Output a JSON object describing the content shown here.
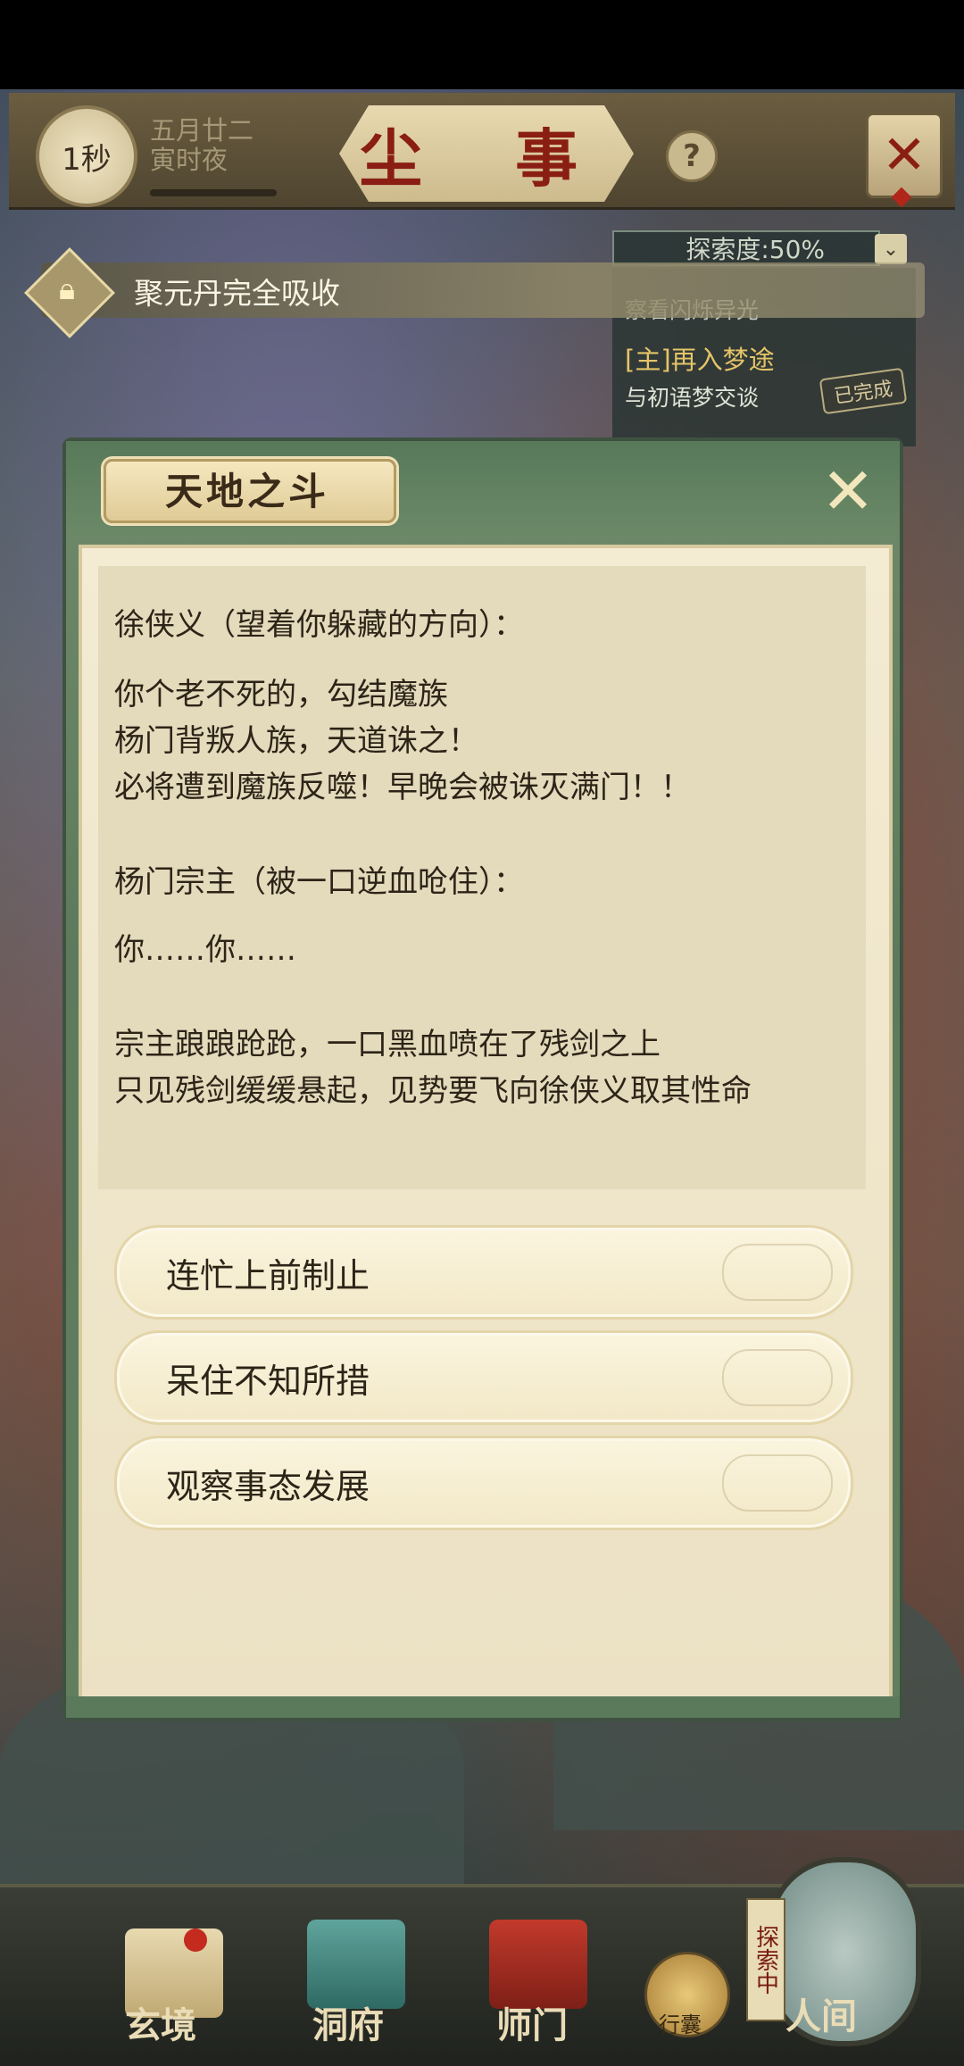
{
  "top_bar": {
    "time_value": "1秒",
    "date_line1": "五月廿二",
    "date_line2": "寅时夜",
    "title": "尘 事",
    "help_icon": "?"
  },
  "quest_panel": {
    "explore_label": "探索度:50%",
    "quests": [
      {
        "title": "[主]再入梦途",
        "subtitle": "与初语梦交谈",
        "status": "已完成"
      }
    ],
    "hidden_sub": "察看闪烁异光"
  },
  "notice": {
    "text": "聚元丹完全吸收",
    "icon": "lock-icon"
  },
  "dialog": {
    "title": "天地之斗",
    "story": [
      "徐侠义（望着你躲藏的方向）：",
      "你个老不死的，勾结魔族",
      "杨门背叛人族，天道诛之！",
      "必将遭到魔族反噬！早晚会被诛灭满门！！",
      "杨门宗主（被一口逆血呛住）：",
      "你……你……",
      "宗主踉踉跄跄，一口黑血喷在了残剑之上",
      "只见残剑缓缓悬起，见势要飞向徐侠义取其性命"
    ],
    "choices": [
      "连忙上前制止",
      "呆住不知所措",
      "观察事态发展"
    ]
  },
  "bottom_nav": {
    "items": [
      "玄境",
      "洞府",
      "师门",
      "人间"
    ],
    "bag_label": "行囊",
    "explore_tag": "探索中"
  }
}
